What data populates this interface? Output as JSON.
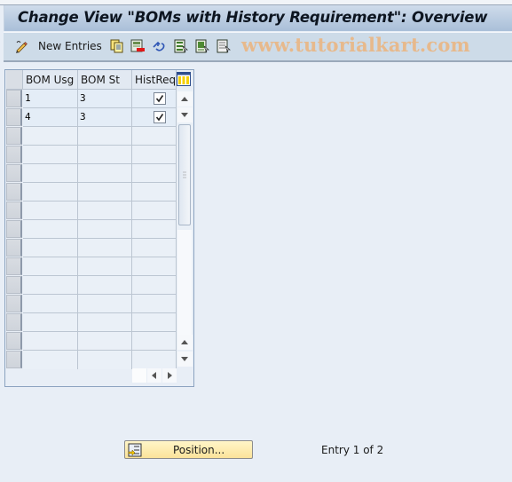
{
  "title": "Change View \"BOMs with History Requirement\": Overview",
  "toolbar": {
    "new_entries_label": "New Entries",
    "icons": [
      "edit-pencil-icon",
      "copy-icon",
      "delete-icon",
      "undo-icon",
      "select-all-icon",
      "select-block-icon",
      "deselect-all-icon"
    ],
    "watermark": "www.tutorialkart.com"
  },
  "table": {
    "columns": [
      "BOM Usg",
      "BOM St",
      "HistReq"
    ],
    "rows": [
      {
        "bom_usg": "1",
        "bom_st": "3",
        "hist_req": true
      },
      {
        "bom_usg": "4",
        "bom_st": "3",
        "hist_req": true
      }
    ],
    "visible_row_count": 15
  },
  "footer": {
    "position_label": "Position...",
    "entry_text": "Entry 1 of 2"
  },
  "colors": {
    "title_gradient_top": "#cfdceb",
    "title_gradient_bottom": "#a9bfd8",
    "toolbar_bg": "#cddbe8",
    "background": "#e8eef6",
    "position_button": "#fbe39a",
    "watermark": "#e7b98c"
  }
}
